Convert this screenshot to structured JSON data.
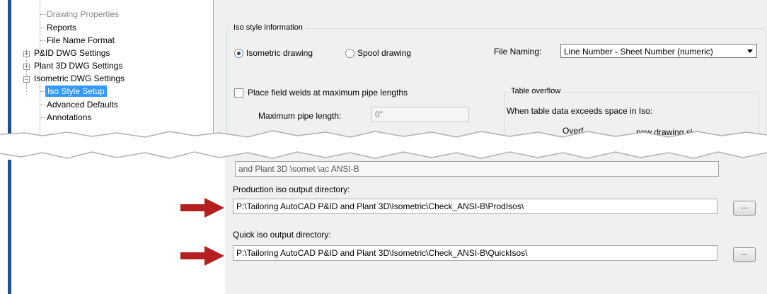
{
  "tree": {
    "items": [
      {
        "label": "Drawing Properties",
        "dim": true
      },
      {
        "label": "Reports"
      },
      {
        "label": "File Name Format"
      },
      {
        "label": "P&ID DWG Settings",
        "expander": "+"
      },
      {
        "label": "Plant 3D DWG Settings",
        "expander": "+"
      },
      {
        "label": "Isometric DWG Settings",
        "expander": "-"
      },
      {
        "label": "Iso Style Setup",
        "selected": true
      },
      {
        "label": "Advanced Defaults"
      },
      {
        "label": "Annotations"
      }
    ]
  },
  "iso_style": {
    "group_title": "Iso style information",
    "radio_isometric": "Isometric drawing",
    "radio_spool": "Spool drawing",
    "file_naming_label": "File Naming:",
    "file_naming_value": "Line Number - Sheet Number (numeric)",
    "field_welds_label": "Place field welds at maximum pipe lengths",
    "max_pipe_label": "Maximum pipe length:",
    "max_pipe_value": "0\"",
    "table_overflow_title": "Table overflow",
    "table_overflow_text": "When table data exceeds space in Iso:",
    "partial_overflow_text": "Overf",
    "partial_new_drawing_text": "new drawing sl"
  },
  "bottom": {
    "partial_path_text": "and Plant 3D \\somet    \\ac    ANSI-B",
    "production_label": "Production iso output directory:",
    "production_value": "P:\\Tailoring AutoCAD P&ID and Plant 3D\\Isometric\\Check_ANSI-B\\ProdIsos\\",
    "quick_label": "Quick iso output directory:",
    "quick_value": "P:\\Tailoring AutoCAD P&ID and Plant 3D\\Isometric\\Check_ANSI-B\\QuickIsos\\",
    "browse_label": "..."
  },
  "colors": {
    "arrow": "#b41f1f",
    "selection": "#3399ff",
    "tree_border": "#1f4f8f",
    "dialog_bg": "#f0f0f0"
  }
}
